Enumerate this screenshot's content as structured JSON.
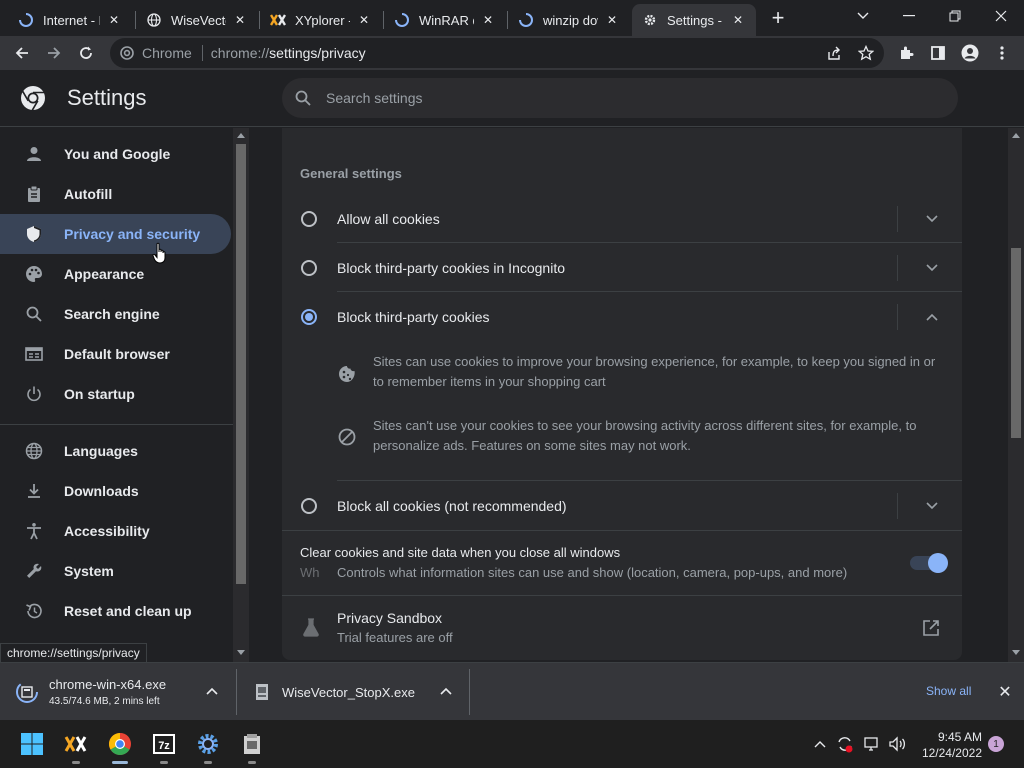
{
  "tabs": [
    {
      "title": "Internet - B"
    },
    {
      "title": "WiseVector"
    },
    {
      "title": "XYplorer - "
    },
    {
      "title": "WinRAR do"
    },
    {
      "title": "winzip dow"
    },
    {
      "title": "Settings - C"
    }
  ],
  "omnibox": {
    "site_chip": "Chrome",
    "url_prefix": "chrome://",
    "url_path": "settings/privacy"
  },
  "settings_header": {
    "title": "Settings",
    "search_placeholder": "Search settings"
  },
  "sidebar": {
    "items": [
      {
        "label": "You and Google",
        "icon": "person-icon"
      },
      {
        "label": "Autofill",
        "icon": "clipboard-icon"
      },
      {
        "label": "Privacy and security",
        "icon": "shield-icon",
        "active": true
      },
      {
        "label": "Appearance",
        "icon": "palette-icon"
      },
      {
        "label": "Search engine",
        "icon": "search-icon"
      },
      {
        "label": "Default browser",
        "icon": "browser-icon"
      },
      {
        "label": "On startup",
        "icon": "power-icon"
      },
      {
        "label": "Languages",
        "icon": "globe-icon"
      },
      {
        "label": "Downloads",
        "icon": "download-icon"
      },
      {
        "label": "Accessibility",
        "icon": "accessibility-icon"
      },
      {
        "label": "System",
        "icon": "wrench-icon"
      },
      {
        "label": "Reset and clean up",
        "icon": "reset-icon"
      }
    ]
  },
  "status_url": "chrome://settings/privacy",
  "cookies": {
    "section_heading": "General settings",
    "options": [
      {
        "label": "Allow all cookies",
        "selected": false
      },
      {
        "label": "Block third-party cookies in Incognito",
        "selected": false
      },
      {
        "label": "Block third-party cookies",
        "selected": true
      },
      {
        "label": "Block all cookies (not recommended)",
        "selected": false
      }
    ],
    "details": [
      "Sites can use cookies to improve your browsing experience, for example, to keep you signed in or to remember items in your shopping cart",
      "Sites can't use your cookies to see your browsing activity across different sites, for example, to personalize ads. Features on some sites may not work."
    ],
    "clear_on_close": {
      "title": "Clear cookies and site data when you close all windows",
      "on": true
    },
    "overlay_sub": "Controls what information sites can use and show (location, camera, pop-ups, and more)",
    "overlay_fragment": "Wh",
    "privacy_sandbox": {
      "title": "Privacy Sandbox",
      "subtitle": "Trial features are off"
    }
  },
  "downloads": {
    "items": [
      {
        "name": "chrome-win-x64.exe",
        "status": "43.5/74.6 MB, 2 mins left"
      },
      {
        "name": "WiseVector_StopX.exe",
        "status": ""
      }
    ],
    "show_all": "Show all"
  },
  "taskbar": {
    "time": "9:45 AM",
    "date": "12/24/2022",
    "notifications": "1"
  },
  "colors": {
    "accent": "#8ab4f8",
    "background": "#202124",
    "card": "#292a2d",
    "active_nav": "#394457"
  }
}
